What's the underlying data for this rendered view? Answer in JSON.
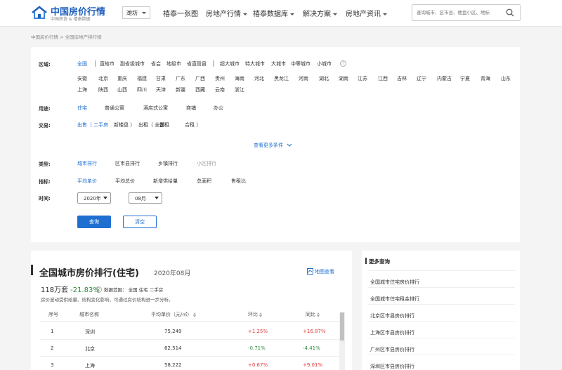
{
  "header": {
    "logo_title": "中国房价行情",
    "logo_subtitle": "中国房协 & 禧泰数据",
    "city": "潍坊",
    "nav": [
      "禧泰一张图",
      "房地产行情",
      "禧泰数据库",
      "解决方案",
      "房地产资讯"
    ],
    "search_placeholder": "查询城市、区市县、楼盘小区、地标"
  },
  "breadcrumb": "中国房价行情 > 全国房地产排行榜",
  "filters": {
    "region_label": "区域:",
    "region_top": [
      "全国",
      "直辖市",
      "副省级城市",
      "省会",
      "地级市",
      "省直管县",
      "超大城市",
      "特大城市",
      "大城市",
      "中等城市",
      "小城市"
    ],
    "region_row2": [
      "安徽",
      "北京",
      "重庆",
      "福建",
      "甘肃",
      "广东",
      "广西",
      "贵州",
      "海南",
      "河北",
      "黑龙江",
      "河南",
      "湖北",
      "湖南",
      "江苏",
      "江西",
      "吉林",
      "辽宁",
      "内蒙古",
      "宁夏",
      "青海",
      "山东"
    ],
    "region_row3": [
      "上海",
      "陕西",
      "山西",
      "四川",
      "天津",
      "新疆",
      "西藏",
      "云南",
      "浙江"
    ],
    "use_label": "用途:",
    "use": [
      "住宅",
      "普通公寓",
      "酒店式公寓",
      "商铺",
      "办公"
    ],
    "deal_label": "交易:",
    "deal": [
      "出售（ 二手房",
      "新楼盘 ）",
      "出租（ 全部",
      "整租",
      "合租 ）"
    ],
    "more": "查看更多条件",
    "type_label": "类型:",
    "type": [
      "城市排行",
      "区市县排行",
      "乡镇排行",
      "小区排行"
    ],
    "index_label": "指标:",
    "index": [
      "平均单价",
      "平均总价",
      "新增供给量",
      "总面积",
      "售租比"
    ],
    "time_label": "时间:",
    "year": "2020年",
    "month": "08月",
    "query_btn": "查询",
    "clear_btn": "清空"
  },
  "main": {
    "title": "全国城市房价排行(住宅)",
    "date": "2020年08月",
    "map_link": "地图查看",
    "count": "118万套",
    "count_change": "-21.83%",
    "scope": "数据范围： 全国   住宅   二手房",
    "note": "房价波动受供给量、结构变化影响，可通过房价结构进一步分析。",
    "columns": [
      "序号",
      "城市名称",
      "平均单价（元/㎡）",
      "环比",
      "同比"
    ],
    "rows": [
      {
        "rank": "1",
        "city": "深圳",
        "price": "75,249",
        "mom": "+1.25%",
        "yoy": "+16.87%"
      },
      {
        "rank": "2",
        "city": "北京",
        "price": "62,514",
        "mom": "-0.71%",
        "yoy": "-4.41%"
      },
      {
        "rank": "3",
        "city": "上海",
        "price": "58,222",
        "mom": "+0.67%",
        "yoy": "+9.01%"
      }
    ]
  },
  "side": {
    "title": "更多查询",
    "links": [
      "全国城市住宅房价排行",
      "全国城市住宅租金排行",
      "北京区市县房价排行",
      "上海区市县房价排行",
      "广州区市县房价排行",
      "深圳区市县房价排行"
    ]
  },
  "colors": {
    "accent": "#1f6fd1",
    "up": "#e03c3c",
    "down": "#2e8b3d"
  }
}
